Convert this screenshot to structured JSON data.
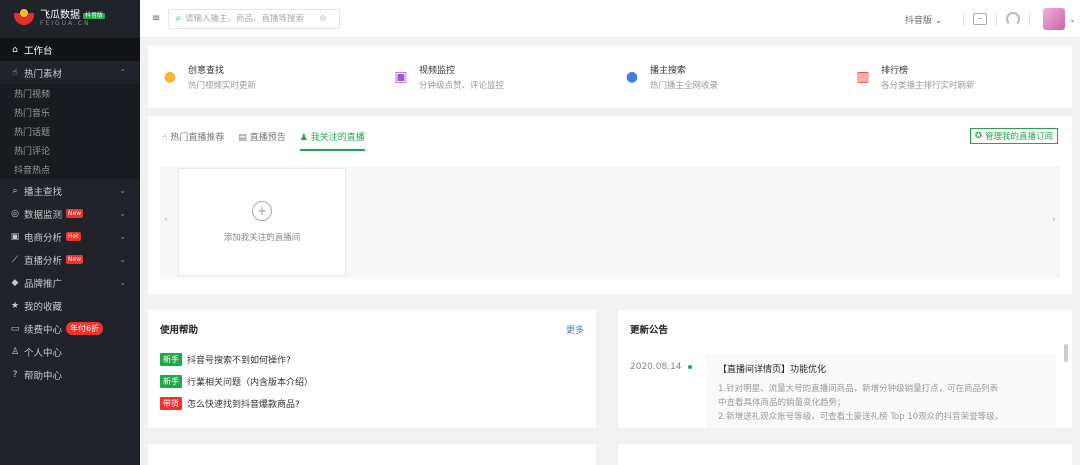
{
  "brand": {
    "name": "飞瓜数据",
    "badge": "抖音版",
    "sub": "FEIGUA.CN"
  },
  "sidebar": {
    "items": [
      {
        "label": "工作台",
        "icon": "home-icon"
      },
      {
        "label": "热门素材",
        "icon": "thumb-icon"
      },
      {
        "label": "播主查找",
        "icon": "search-icon"
      },
      {
        "label": "数据监测",
        "icon": "eye-icon",
        "badge": "New"
      },
      {
        "label": "电商分析",
        "icon": "bag-icon",
        "badge": "Hot"
      },
      {
        "label": "直播分析",
        "icon": "trend-icon",
        "badge": "New"
      },
      {
        "label": "品牌推广",
        "icon": "diamond-icon"
      },
      {
        "label": "我的收藏",
        "icon": "star-icon"
      },
      {
        "label": "续费中心",
        "icon": "card-icon",
        "badge": "年付6折"
      },
      {
        "label": "个人中心",
        "icon": "user-icon"
      },
      {
        "label": "帮助中心",
        "icon": "help-icon"
      }
    ],
    "sub_items": [
      "热门视频",
      "热门音乐",
      "热门话题",
      "热门评论",
      "抖音热点"
    ]
  },
  "header": {
    "search_placeholder": "请输入播主、商品、直播等搜索",
    "platform": "抖音版"
  },
  "cards": [
    {
      "title": "创意查找",
      "sub": "热门视频实时更新"
    },
    {
      "title": "视频监控",
      "sub": "分钟级点赞、评论监控"
    },
    {
      "title": "播主搜索",
      "sub": "热门播主全网收录"
    },
    {
      "title": "排行榜",
      "sub": "各分类播主排行实时刷新"
    }
  ],
  "live": {
    "tabs": [
      "热门直播推荐",
      "直播预告",
      "我关注的直播"
    ],
    "manage": "管理我的直播订阅",
    "add": "添加我关注的直播间"
  },
  "help": {
    "title": "使用帮助",
    "more": "更多",
    "rows": [
      {
        "tag": "新手",
        "text": "抖音号搜索不到如何操作?"
      },
      {
        "tag": "新手",
        "text": "行業相关问题（内含版本介绍）"
      },
      {
        "tag": "带货",
        "text": "怎么快速找到抖音爆款商品?"
      }
    ]
  },
  "news": {
    "title": "更新公告",
    "date": "2020.08.14",
    "item_title": "【直播间详情页】功能优化",
    "lines": [
      "1.针对明星、流量大号的直播间商品，新增分钟级销量打点，可在商品列表",
      "中查看具体商品的销量变化趋势；",
      "2.新增送礼观众账号等级，可查看土豪送礼榜 Top 10观众的抖音荣誉等级。"
    ]
  },
  "colors": {
    "accent": "#22a84a",
    "sidebar": "#1f2329",
    "badge": "#f0322d",
    "link": "#4a7bd0"
  }
}
